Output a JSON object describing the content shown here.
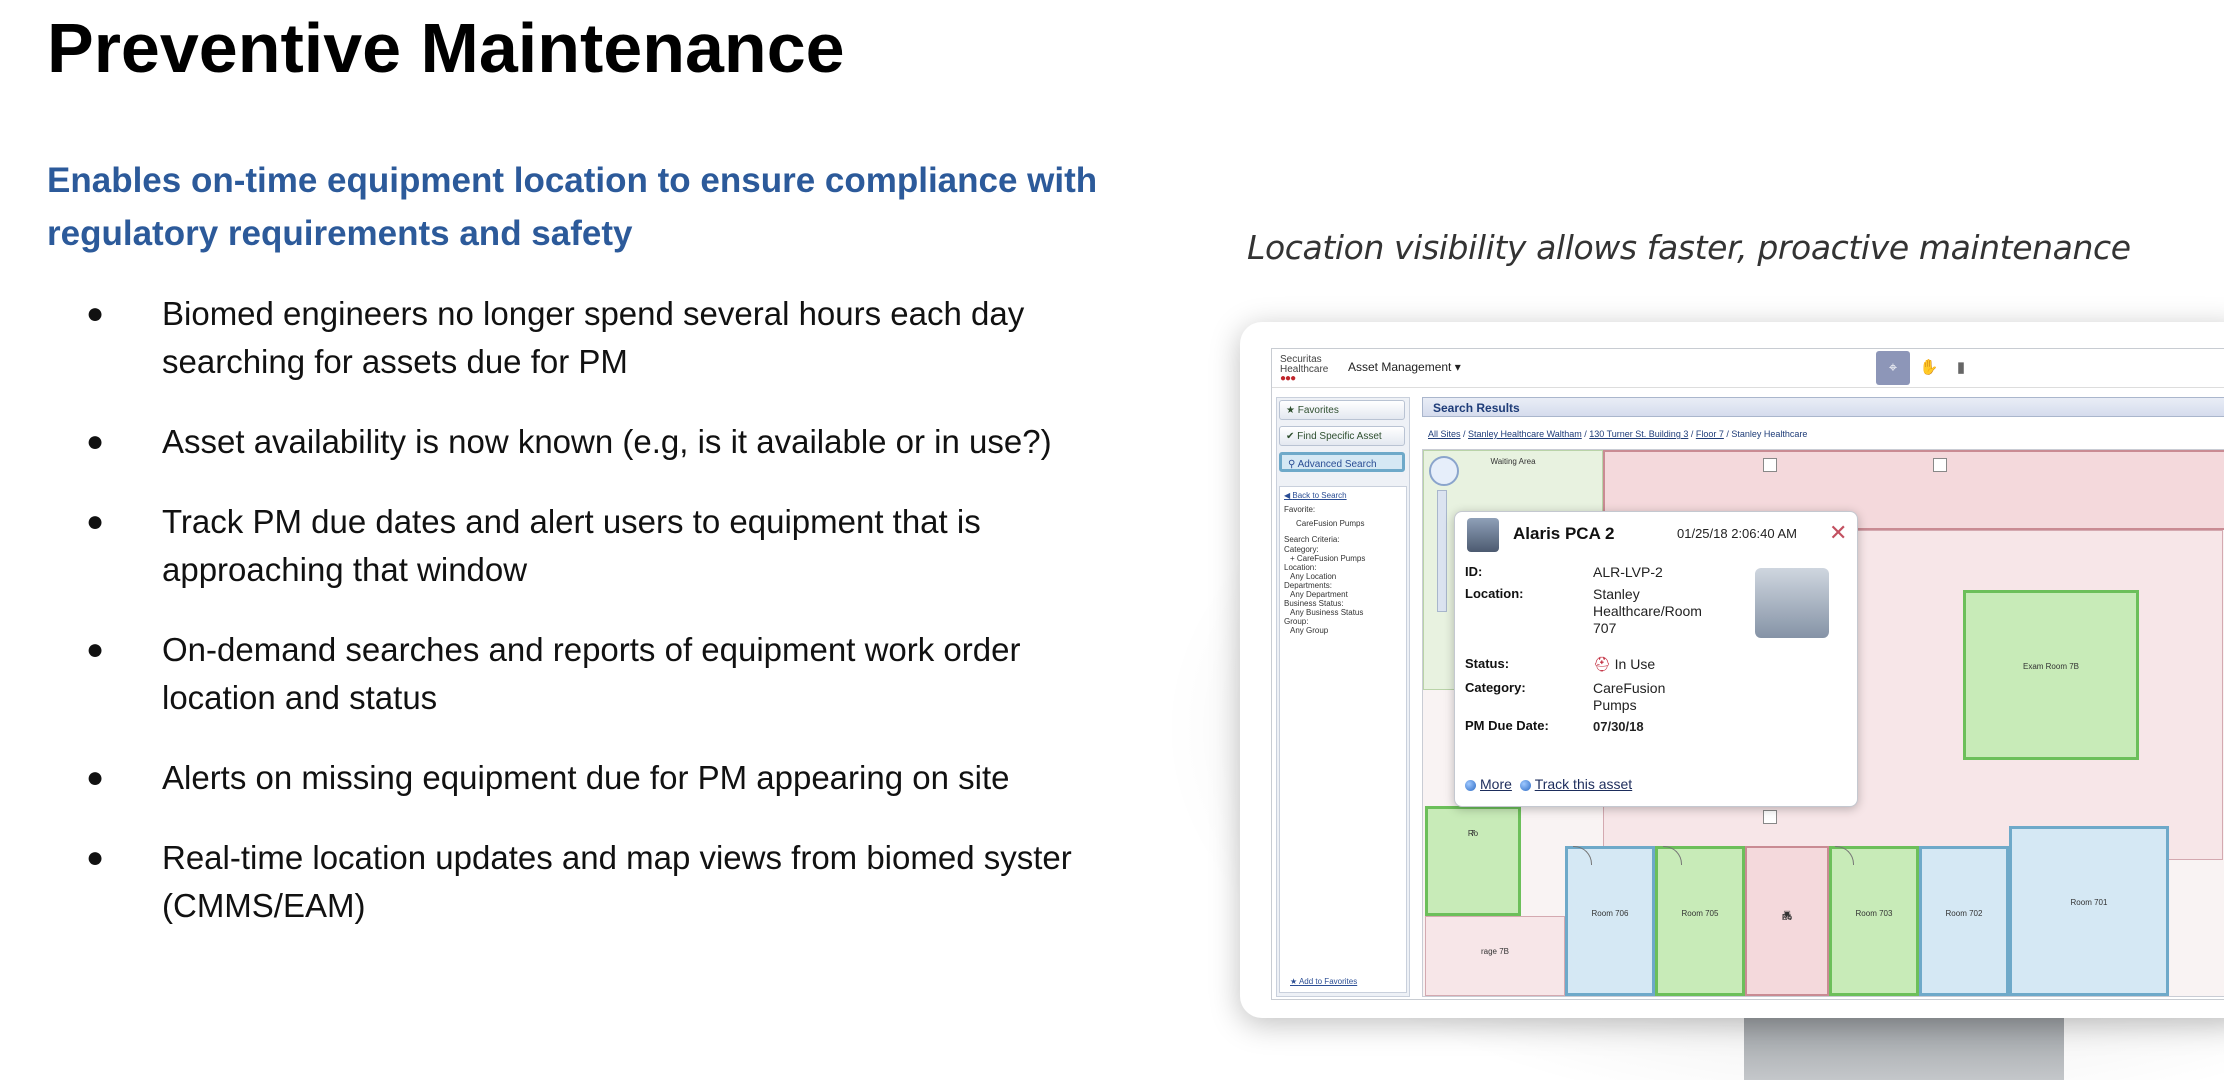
{
  "slide": {
    "title": "Preventive Maintenance",
    "subtitle": "Enables on-time equipment location to ensure compliance with regulatory requirements and safety",
    "bullets": [
      "Biomed engineers no longer spend several hours each day searching for assets due for PM",
      "Asset availability is now known (e.g, is it available or in use?)",
      "Track PM due dates and alert users to equipment that is approaching that window",
      "On-demand searches and reports of equipment work order location and status",
      "Alerts on missing equipment due for PM appearing on site",
      "Real-time location updates and map views from biomed syster (CMMS/EAM)"
    ],
    "bullet_glyph": "●",
    "caption": "Location visibility allows faster, proactive maintenance",
    "colors": {
      "subtitle": "#2c5a9a",
      "popup_close": "#c25060"
    }
  },
  "app": {
    "brand_line1": "Securitas",
    "brand_line2": "Healthcare",
    "brand_dots": "●●●",
    "menu": "Asset Management ▾",
    "toolbar_icons": [
      "locate-icon",
      "hand-icon",
      "chart-icon"
    ],
    "sidebar": {
      "favorites_btn": "Favorites",
      "find_btn": "Find Specific Asset",
      "advanced_btn": "Advanced Search",
      "back_link": "Back to Search",
      "favorite_label": "Favorite:",
      "favorite_value": "CareFusion Pumps",
      "criteria_label": "Search Criteria:",
      "category_label": "Category:",
      "category_value": "+ CareFusion Pumps",
      "location_label": "Location:",
      "location_value": "Any Location",
      "departments_label": "Departments:",
      "departments_value": "Any Department",
      "business_label": "Business Status:",
      "business_value": "Any Business Status",
      "group_label": "Group:",
      "group_value": "Any Group",
      "add_fav": "Add to Favorites"
    },
    "results_title": "Search Results",
    "breadcrumb": {
      "all_sites": "All Sites",
      "site": "Stanley Healthcare Waltham",
      "building": "130 Turner St. Building 3",
      "floor": "Floor 7",
      "current": "Stanley Healthcare",
      "sep": " / "
    },
    "map": {
      "waiting": "Waiting Area",
      "exam": "Exam Room 7B",
      "room706": "Room 706",
      "room705": "Room 705",
      "room704": "Ro",
      "room704b": "04",
      "room703": "Room 703",
      "room702": "Room 702",
      "room701": "Room 701",
      "storage": "rage 7B",
      "ro_left": "Ro",
      "ro_left_num": "7"
    },
    "popup": {
      "title": "Alaris PCA 2",
      "timestamp": "01/25/18 2:06:40 AM",
      "close": "✕",
      "id_label": "ID:",
      "id_value": "ALR-LVP-2",
      "location_label": "Location:",
      "location_value": "Stanley Healthcare/Room 707",
      "status_label": "Status:",
      "status_value": "In Use",
      "category_label": "Category:",
      "category_value": "CareFusion Pumps",
      "pm_label": "PM Due Date:",
      "pm_value": "07/30/18",
      "more_link": "More",
      "track_link": "Track this asset"
    }
  }
}
